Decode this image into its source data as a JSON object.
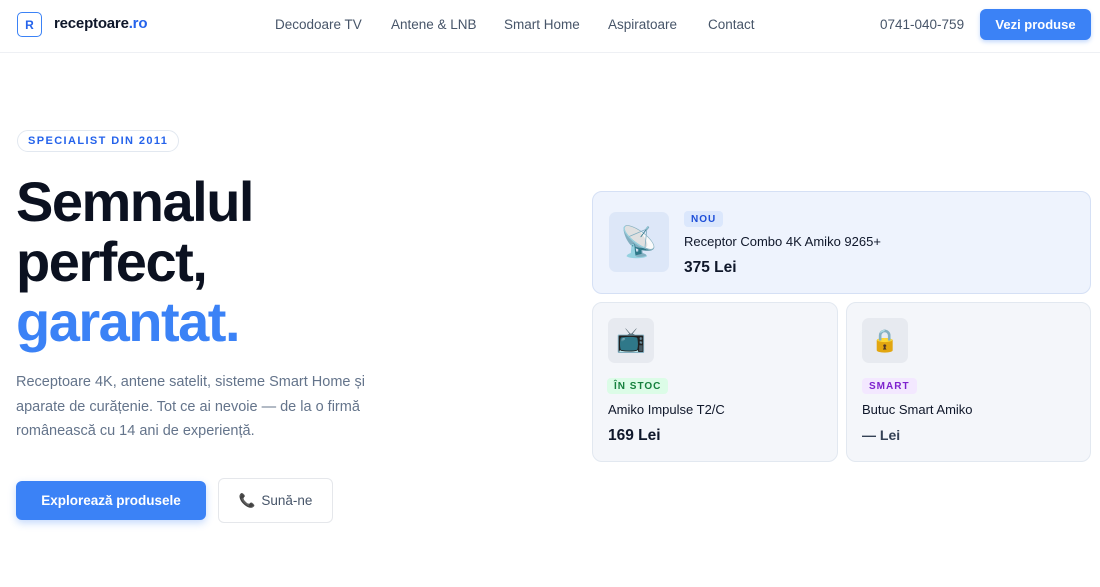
{
  "brand": {
    "logo_letter": "R",
    "name_main": "receptoare",
    "name_tld": ".ro"
  },
  "nav": {
    "items": [
      {
        "label": "Decodoare TV"
      },
      {
        "label": "Antene & LNB"
      },
      {
        "label": "Smart Home"
      },
      {
        "label": "Aspiratoare"
      },
      {
        "label": "Contact"
      }
    ],
    "phone": "0741-040-759",
    "cta": "Vezi produse"
  },
  "hero": {
    "badge": "SPECIALIST DIN 2011",
    "title_line1": "Semnalul",
    "title_line2": "perfect,",
    "title_line3": "garantat.",
    "lead": "Receptoare 4K, antene satelit, sisteme Smart Home și aparate de curățenie. Tot ce ai nevoie — de la o firmă românească cu 14 ani de experiență.",
    "primary_button": "Explorează produsele",
    "secondary_button": "Sună-ne",
    "secondary_icon": "phone-icon"
  },
  "products": [
    {
      "tag": "NOU",
      "name": "Receptor Combo 4K Amiko 9265+",
      "price": "375 Lei",
      "icon": "satellite-dish-icon",
      "icon_glyph": "📡",
      "accent": "#3b82f6"
    },
    {
      "tag": "ÎN STOC",
      "name": "Amiko Impulse T2/C",
      "price": "169 Lei",
      "icon": "tv-icon",
      "icon_glyph": "📺",
      "accent": "#15803d"
    },
    {
      "tag": "SMART",
      "name": "Butuc Smart Amiko",
      "price": "— Lei",
      "icon": "lock-icon",
      "icon_glyph": "🔒",
      "accent": "#7e22ce"
    }
  ]
}
